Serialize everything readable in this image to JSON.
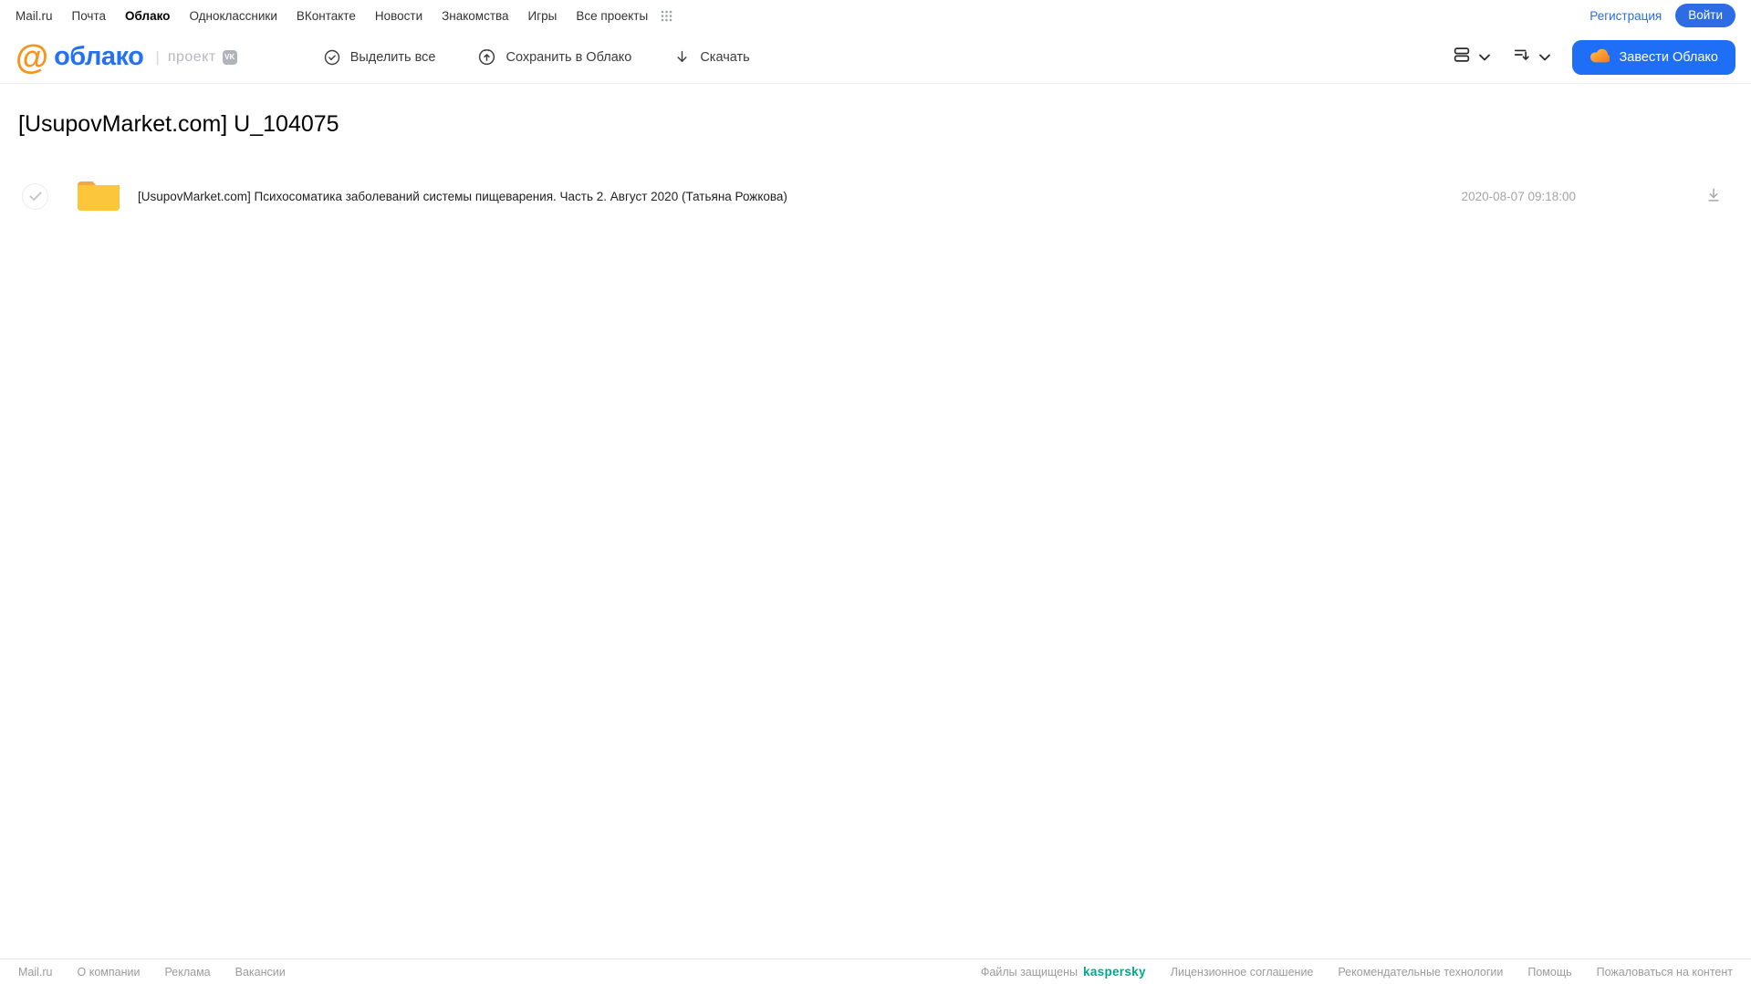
{
  "top_nav": {
    "items": [
      {
        "label": "Mail.ru"
      },
      {
        "label": "Почта"
      },
      {
        "label": "Облако",
        "active": true
      },
      {
        "label": "Одноклассники"
      },
      {
        "label": "ВКонтакте"
      },
      {
        "label": "Новости"
      },
      {
        "label": "Знакомства"
      },
      {
        "label": "Игры"
      },
      {
        "label": "Все проекты"
      }
    ],
    "apps_grid_icon": "grid-dots-icon",
    "registration_label": "Регистрация",
    "login_label": "Войти"
  },
  "toolbar": {
    "logo_at": "@",
    "logo_text": "облако",
    "logo_separator": "|",
    "logo_project_label": "проект",
    "vk_badge_label": "VK",
    "actions": [
      {
        "label": "Выделить все",
        "icon": "check-circle-icon"
      },
      {
        "label": "Сохранить в Облако",
        "icon": "cloud-upload-icon"
      },
      {
        "label": "Скачать",
        "icon": "download-arrow-icon"
      }
    ],
    "view_icons": [
      "list-view-icon",
      "chevron-down-icon",
      "sort-icon",
      "chevron-down-icon"
    ],
    "get_cloud_label": "Завести Облако",
    "get_cloud_icon": "orange-cloud-icon"
  },
  "main": {
    "title": "[UsupovMarket.com] U_104075",
    "files": [
      {
        "type": "folder",
        "icon": "folder-icon",
        "name": "[UsupovMarket.com] Психосоматика заболеваний системы пищеварения. Часть 2. Август 2020 (Татьяна Рожкова)",
        "date": "2020-08-07 09:18:00",
        "row_icons": [
          "checkbox-circle-icon",
          "download-icon"
        ]
      }
    ]
  },
  "footer": {
    "left_links": [
      "Mail.ru",
      "О компании",
      "Реклама",
      "Вакансии"
    ],
    "protected_label": "Файлы защищены",
    "kaspersky_label": "kaspersky",
    "right_links": [
      "Лицензионное соглашение",
      "Рекомендательные технологии",
      "Помощь",
      "Пожаловаться на контент"
    ]
  },
  "colors": {
    "accent_blue": "#1f6ef6",
    "link_blue": "#2d6ce5",
    "logo_blue": "#2571f2",
    "logo_orange": "#f7941d",
    "folder_yellow": "#fbc53c",
    "kaspersky_teal": "#00a88e",
    "muted_gray": "#a5a5a5"
  }
}
